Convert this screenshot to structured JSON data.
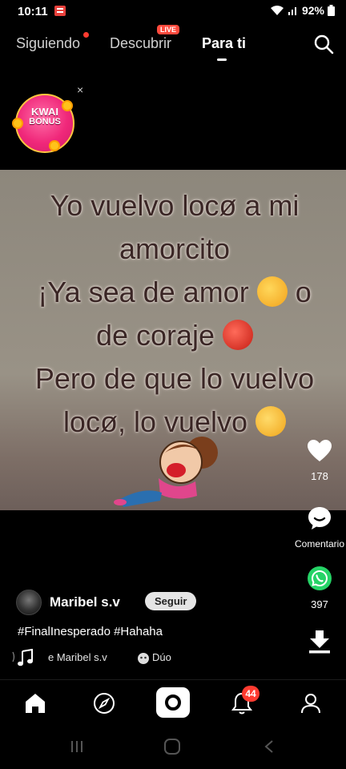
{
  "status_bar": {
    "time": "10:11",
    "battery": "92%",
    "icons": [
      "notification-icon",
      "wifi-icon",
      "signal-icon",
      "battery-icon"
    ]
  },
  "top_nav": {
    "tabs": [
      {
        "label": "Siguiendo",
        "has_dot": true
      },
      {
        "label": "Descubrir",
        "badge": "LIVE"
      },
      {
        "label": "Para ti",
        "active": true
      }
    ],
    "search_icon": "search-icon"
  },
  "kwai_bonus": {
    "line1": "KWAI",
    "line2": "BONUS",
    "close": "×"
  },
  "video": {
    "line1": "Yo vuelvo locø a mi",
    "line2": "amorcito",
    "line3a": "¡Ya sea de amor",
    "line3b": "o",
    "line4": "de coraje",
    "line5": "Pero de que lo vuelvo",
    "line6": "locø, lo vuelvo"
  },
  "actions": {
    "like_count": "178",
    "comment_label": "Comentario",
    "share_count": "397"
  },
  "author": {
    "name": "Maribel s.v",
    "follow_label": "Seguir"
  },
  "caption": "#FinalInesperado #Hahaha",
  "music": {
    "text": "e Maribel s.v",
    "duo_label": "Dúo"
  },
  "bottom_nav": {
    "items": [
      "home-icon",
      "explore-icon",
      "camera-icon",
      "bell-icon",
      "profile-icon"
    ],
    "notification_count": "44"
  },
  "colors": {
    "accent_red": "#ff3b30",
    "whatsapp_green": "#25d366",
    "video_text": "#3a2625"
  }
}
